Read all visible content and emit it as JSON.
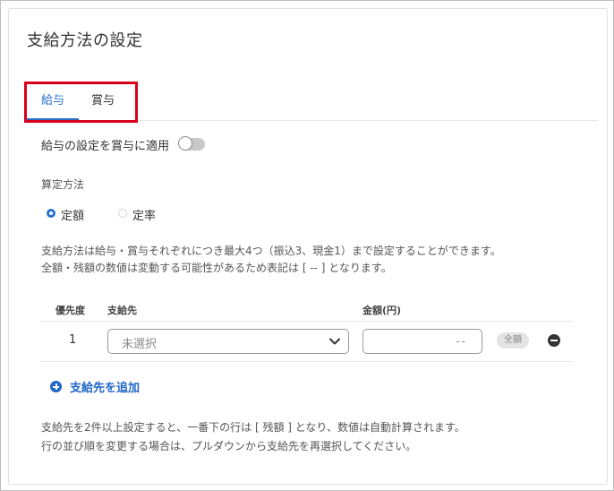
{
  "title": "支給方法の設定",
  "tabs": [
    {
      "label": "給与",
      "active": true
    },
    {
      "label": "賞与",
      "active": false
    }
  ],
  "apply_toggle": {
    "label": "給与の設定を賞与に適用",
    "on": false
  },
  "calc_method": {
    "label": "算定方法",
    "options": [
      {
        "label": "定額",
        "selected": true
      },
      {
        "label": "定率",
        "selected": false
      }
    ]
  },
  "description": [
    "支給方法は給与・賞与それぞれにつき最大4つ（振込3、現金1）まで設定することができます。",
    "全額・残額の数値は変動する可能性があるため表記は [ -- ] となります。"
  ],
  "table": {
    "headers": {
      "priority": "優先度",
      "destination": "支給先",
      "amount": "金額(円)"
    },
    "rows": [
      {
        "priority": "1",
        "destination_placeholder": "未選択",
        "amount_placeholder": "--",
        "badge": "全額"
      }
    ]
  },
  "add_button": "支給先を追加",
  "notes": [
    "支給先を2件以上設定すると、一番下の行は [ 残額 ] となり、数値は自動計算されます。",
    "行の並び順を変更する場合は、プルダウンから支給先を再選択してください。"
  ],
  "colors": {
    "accent": "#2a6fc9",
    "highlight_border": "#d9001b"
  }
}
